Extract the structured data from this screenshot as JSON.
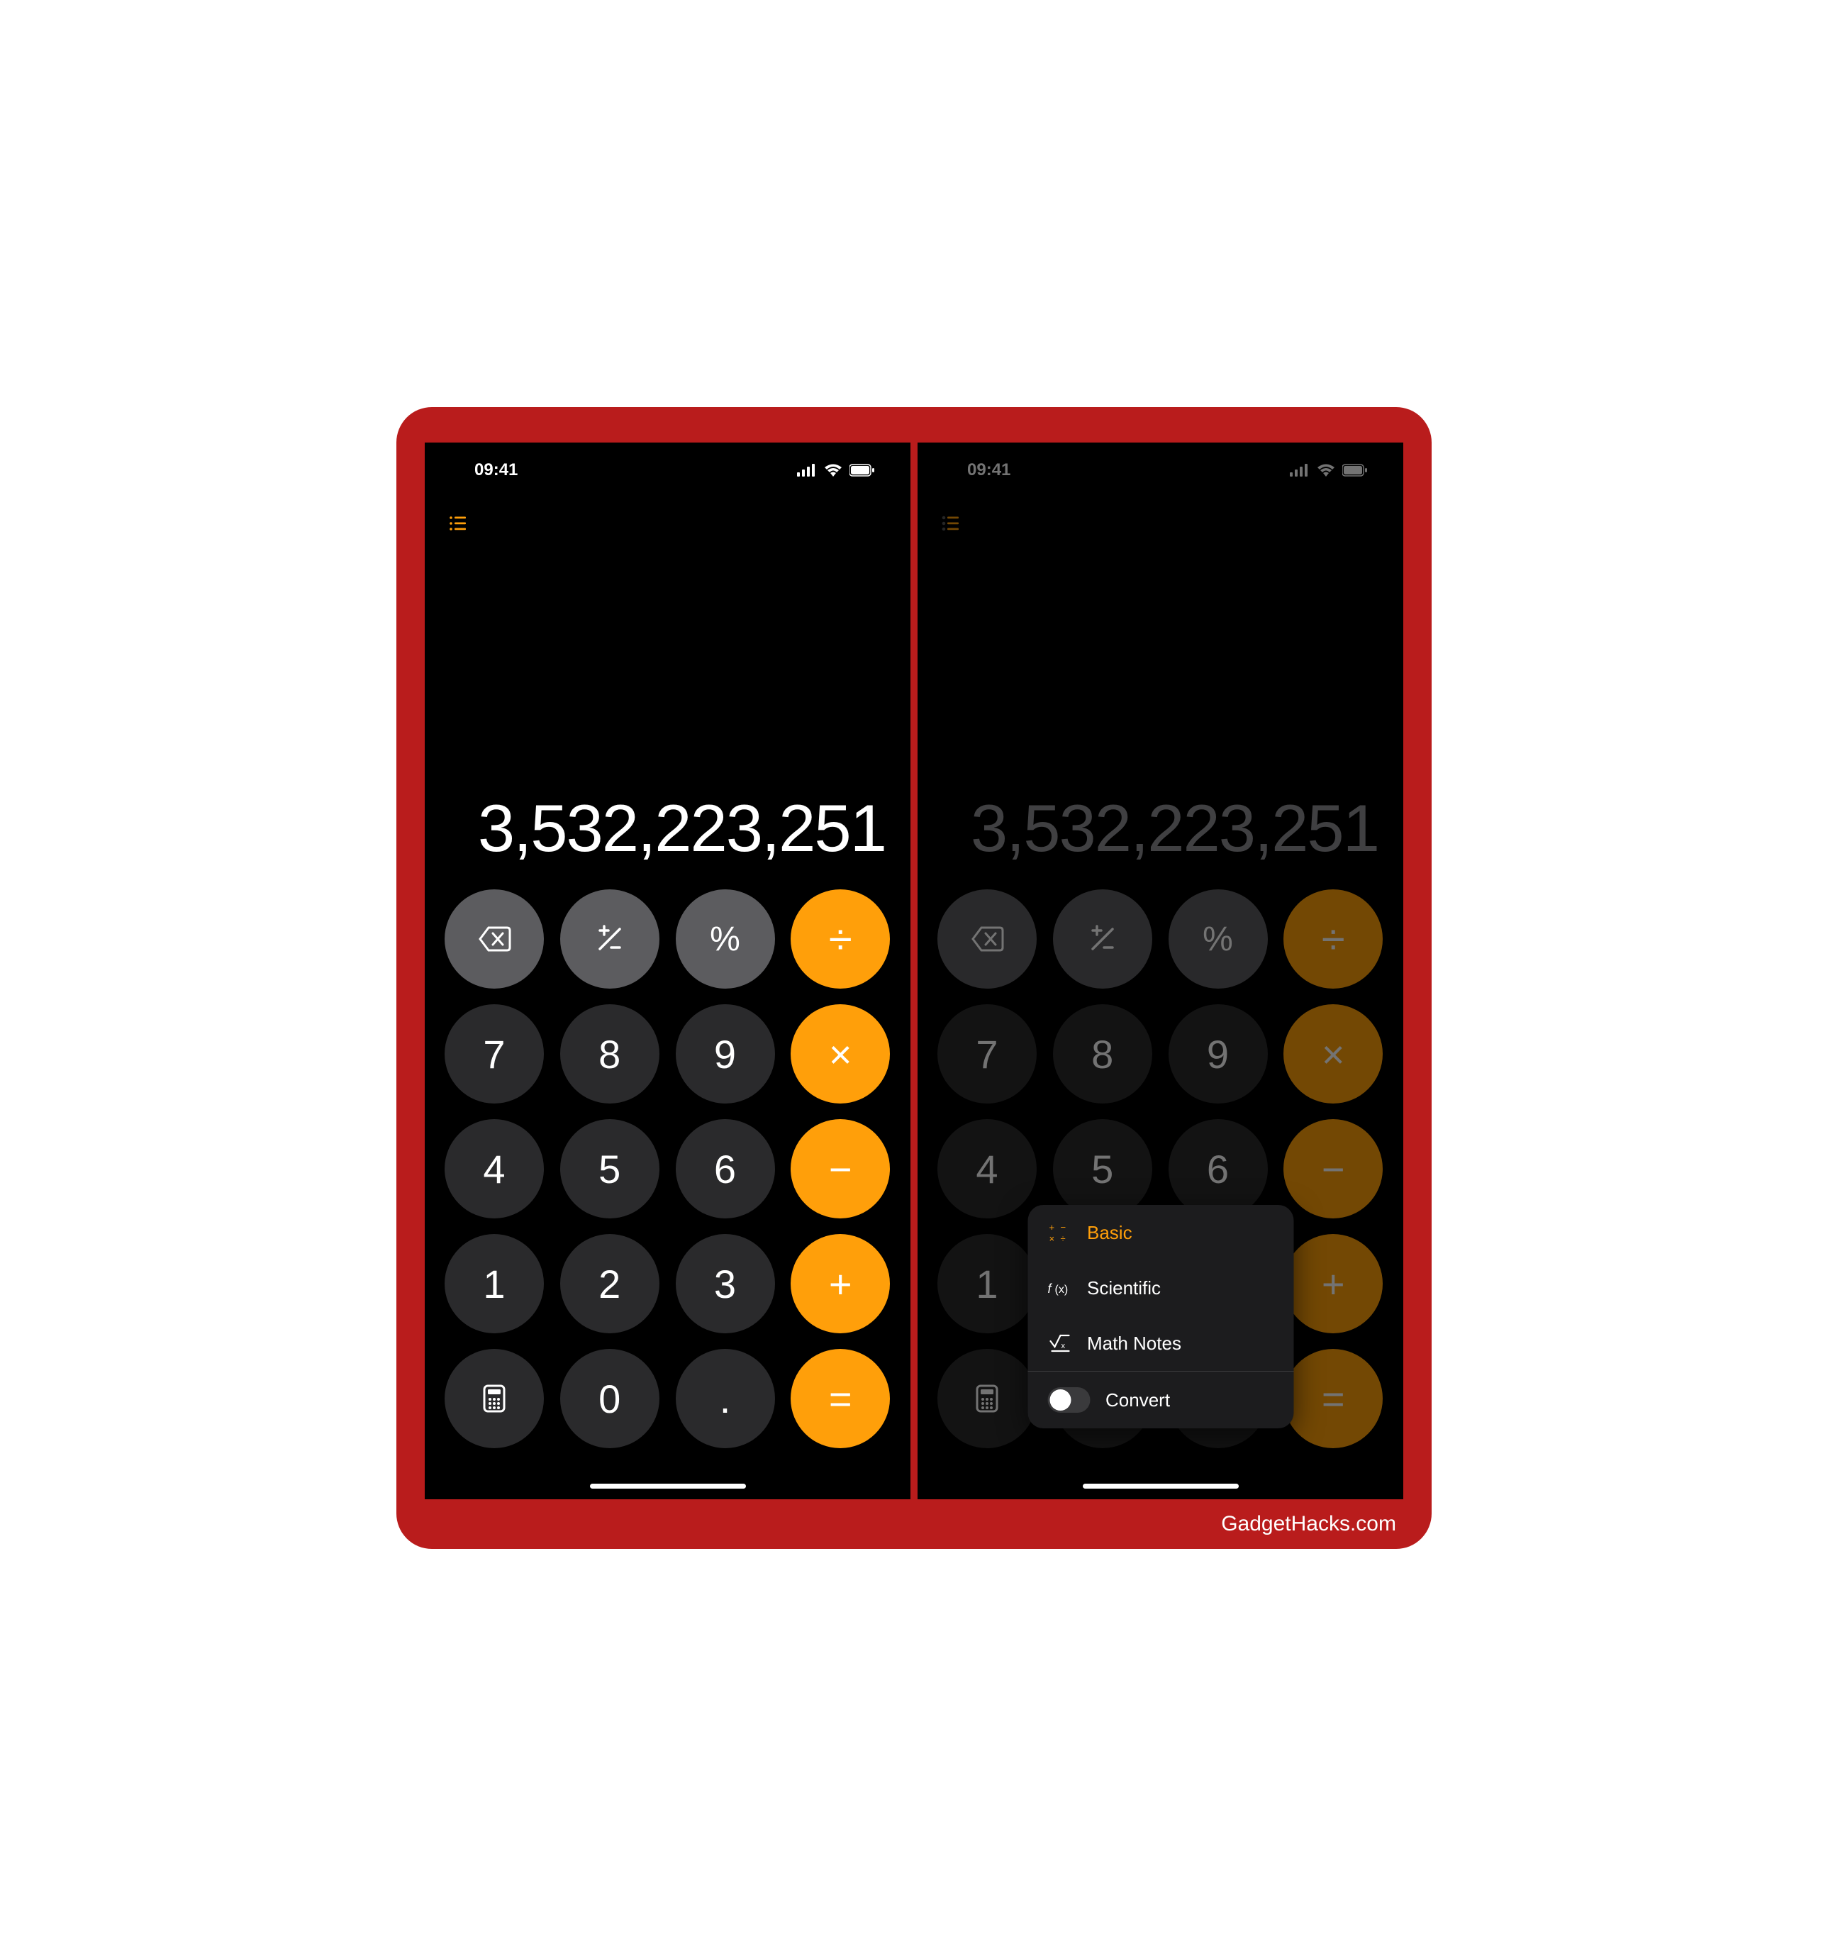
{
  "status": {
    "time": "09:41"
  },
  "display_value": "3,532,223,251",
  "keys": {
    "backspace": "⌫",
    "plus_minus": "±",
    "percent": "%",
    "divide": "÷",
    "seven": "7",
    "eight": "8",
    "nine": "9",
    "multiply": "×",
    "four": "4",
    "five": "5",
    "six": "6",
    "minus": "−",
    "one": "1",
    "two": "2",
    "three": "3",
    "plus": "+",
    "calculator": "calc",
    "zero": "0",
    "decimal": ".",
    "equals": "="
  },
  "menu": {
    "basic": "Basic",
    "scientific": "Scientific",
    "math_notes": "Math Notes",
    "convert": "Convert"
  },
  "watermark": "GadgetHacks.com",
  "colors": {
    "frame_bg": "#b91c1c",
    "orange": "#ff9f0a",
    "light_gray": "#5c5c5f",
    "dark_gray": "#2a2a2c"
  }
}
